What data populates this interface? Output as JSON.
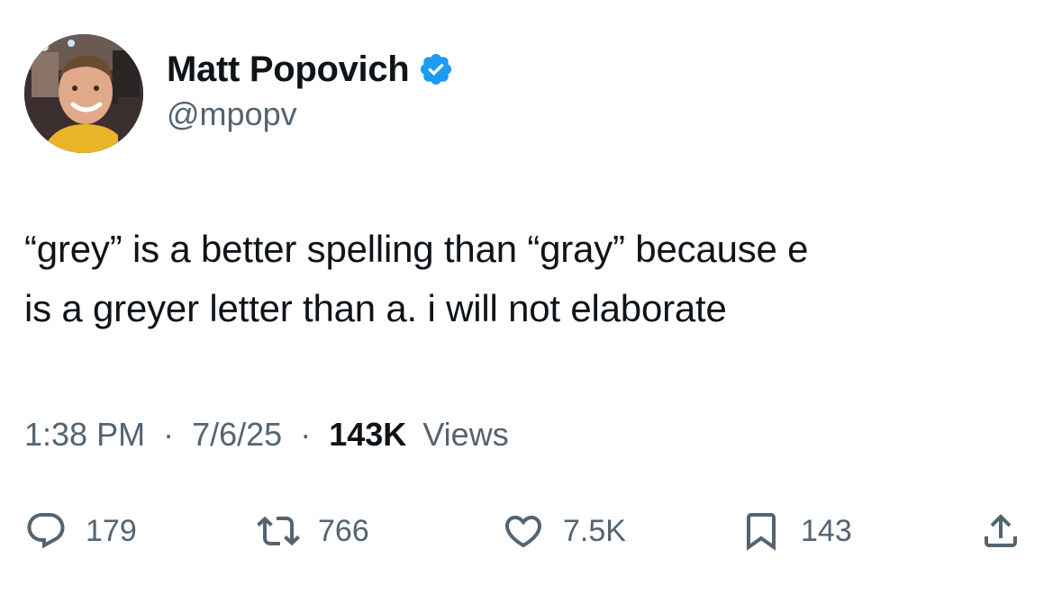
{
  "author": {
    "display_name": "Matt Popovich",
    "handle": "@mpopv",
    "verified": true
  },
  "tweet": {
    "line1": "“grey” is a better spelling than “gray” because e",
    "line2": "is a greyer letter than a. i will not elaborate"
  },
  "meta": {
    "time": "1:38 PM",
    "separator": "·",
    "date": "7/6/25",
    "views_count": "143K",
    "views_label": "Views"
  },
  "actions": {
    "replies": "179",
    "reposts": "766",
    "likes": "7.5K",
    "bookmarks": "143"
  },
  "colors": {
    "text": "#0f1419",
    "secondary": "#536471",
    "verified": "#1d9bf0"
  },
  "icons": [
    "reply-icon",
    "repost-icon",
    "like-icon",
    "bookmark-icon",
    "share-icon",
    "verified-badge-icon"
  ]
}
